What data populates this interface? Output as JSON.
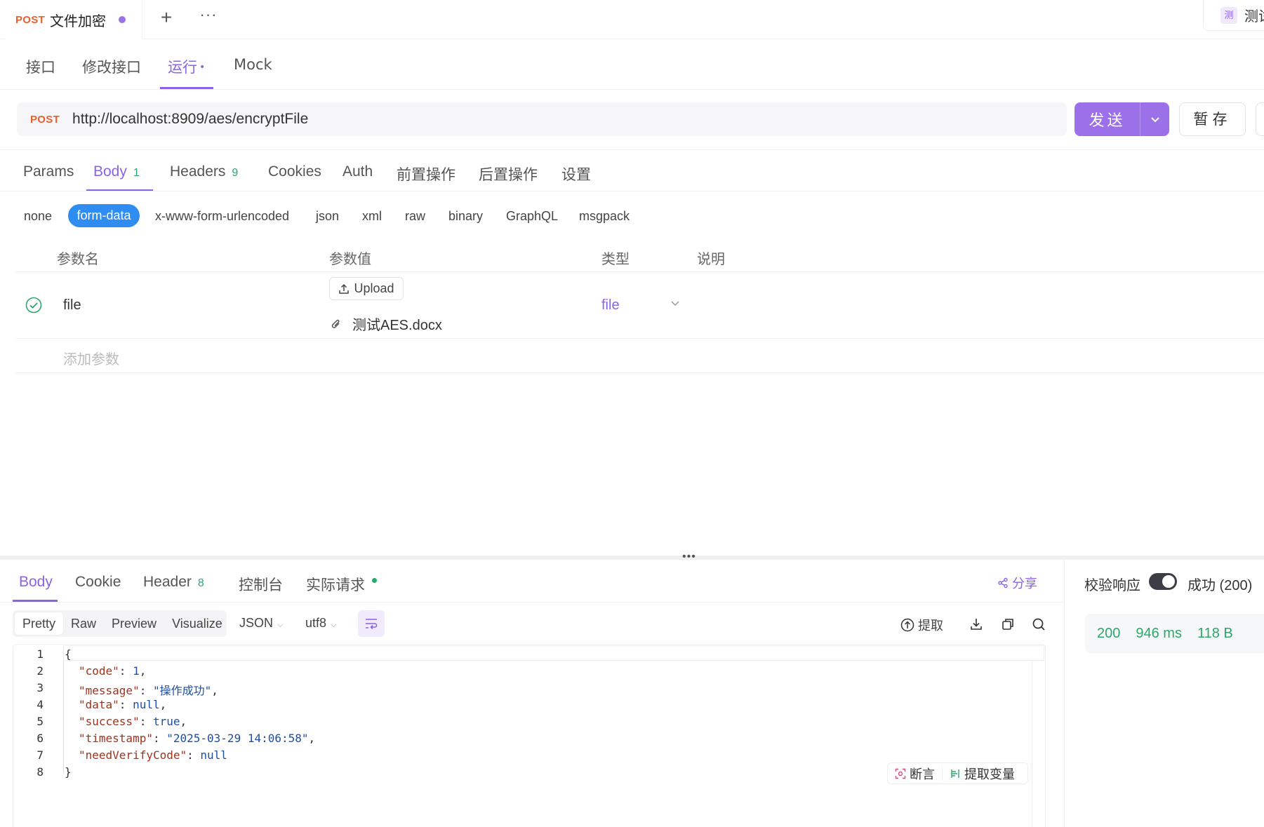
{
  "top": {
    "tab_method": "POST",
    "tab_title": "文件加密",
    "plus": "+",
    "more": "···",
    "env_badge": "测",
    "env_name": "测试"
  },
  "mode_tabs": [
    "接口",
    "修改接口",
    "运行",
    "Mock"
  ],
  "mode_active_dot": "•",
  "url_bar": {
    "method": "POST",
    "url": "http://localhost:8909/aes/encryptFile",
    "send_label": "发送",
    "save_label": "暂存"
  },
  "request_tabs": [
    {
      "label": "Params",
      "count": ""
    },
    {
      "label": "Body",
      "count": "1"
    },
    {
      "label": "Headers",
      "count": "9"
    },
    {
      "label": "Cookies",
      "count": ""
    },
    {
      "label": "Auth",
      "count": ""
    },
    {
      "label": "前置操作",
      "count": ""
    },
    {
      "label": "后置操作",
      "count": ""
    },
    {
      "label": "设置",
      "count": ""
    }
  ],
  "body_types": [
    "none",
    "form-data",
    "x-www-form-urlencoded",
    "json",
    "xml",
    "raw",
    "binary",
    "GraphQL",
    "msgpack"
  ],
  "params_table": {
    "headers": [
      "参数名",
      "参数值",
      "类型",
      "说明"
    ],
    "rows": [
      {
        "name": "file",
        "upload_label": "Upload",
        "file_name": "测试AES.docx",
        "type": "file",
        "description": ""
      }
    ],
    "add_placeholder": "添加参数"
  },
  "response_tabs": [
    {
      "label": "Body",
      "count": ""
    },
    {
      "label": "Cookie",
      "count": ""
    },
    {
      "label": "Header",
      "count": "8"
    },
    {
      "label": "控制台",
      "count": ""
    },
    {
      "label": "实际请求",
      "count": ""
    }
  ],
  "share_label": "分享",
  "verify": {
    "label": "校验响应",
    "enabled": true,
    "result": "成功 (200)"
  },
  "status": {
    "code": "200",
    "time": "946 ms",
    "size": "118 B"
  },
  "view_modes": [
    "Pretty",
    "Raw",
    "Preview",
    "Visualize"
  ],
  "format": "JSON",
  "encoding": "utf8",
  "extract_label": "提取",
  "code_actions": {
    "assert": "断言",
    "extract_var": "提取变量"
  },
  "response_json_lines": [
    "{",
    "\"code\": 1,",
    "\"message\": \"操作成功\",",
    "\"data\": null,",
    "\"success\": true,",
    "\"timestamp\": \"2025-03-29 14:06:58\",",
    "\"needVerifyCode\": null",
    "}"
  ],
  "colors": {
    "accent": "#9b70e8",
    "method": "#e8602c",
    "success": "#2aa86a",
    "form_data_pill": "#2f8cf0"
  }
}
